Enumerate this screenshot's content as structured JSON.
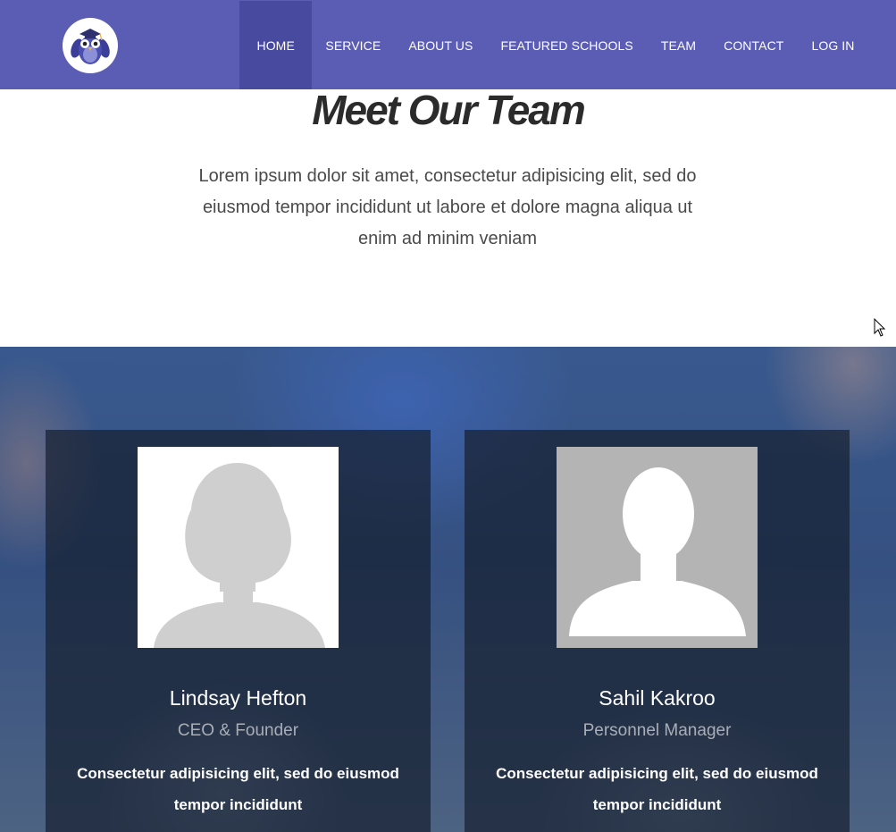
{
  "header": {
    "logo": "owl-graduate-logo",
    "nav": [
      {
        "label": "HOME",
        "active": true
      },
      {
        "label": "SERVICE"
      },
      {
        "label": "ABOUT US"
      },
      {
        "label": "FEATURED SCHOOLS"
      },
      {
        "label": "TEAM"
      },
      {
        "label": "CONTACT"
      },
      {
        "label": "LOG IN"
      }
    ]
  },
  "intro": {
    "title": "Meet Our Team",
    "text": "Lorem ipsum dolor sit amet, consectetur adipisicing elit, sed do eiusmod tempor incididunt ut labore et dolore magna aliqua ut enim ad minim veniam"
  },
  "team": {
    "members": [
      {
        "name": "Lindsay Hefton",
        "role": "CEO & Founder",
        "description": "Consectetur adipisicing elit, sed do eiusmod tempor incididunt",
        "avatar": "female-silhouette"
      },
      {
        "name": "Sahil Kakroo",
        "role": "Personnel Manager",
        "description": "Consectetur adipisicing elit, sed do eiusmod tempor incididunt",
        "avatar": "male-silhouette"
      }
    ]
  },
  "colors": {
    "navbar": "#5b5db4",
    "nav_active": "#474a9f",
    "card_overlay": "#162030",
    "title": "#2b2b2b"
  }
}
